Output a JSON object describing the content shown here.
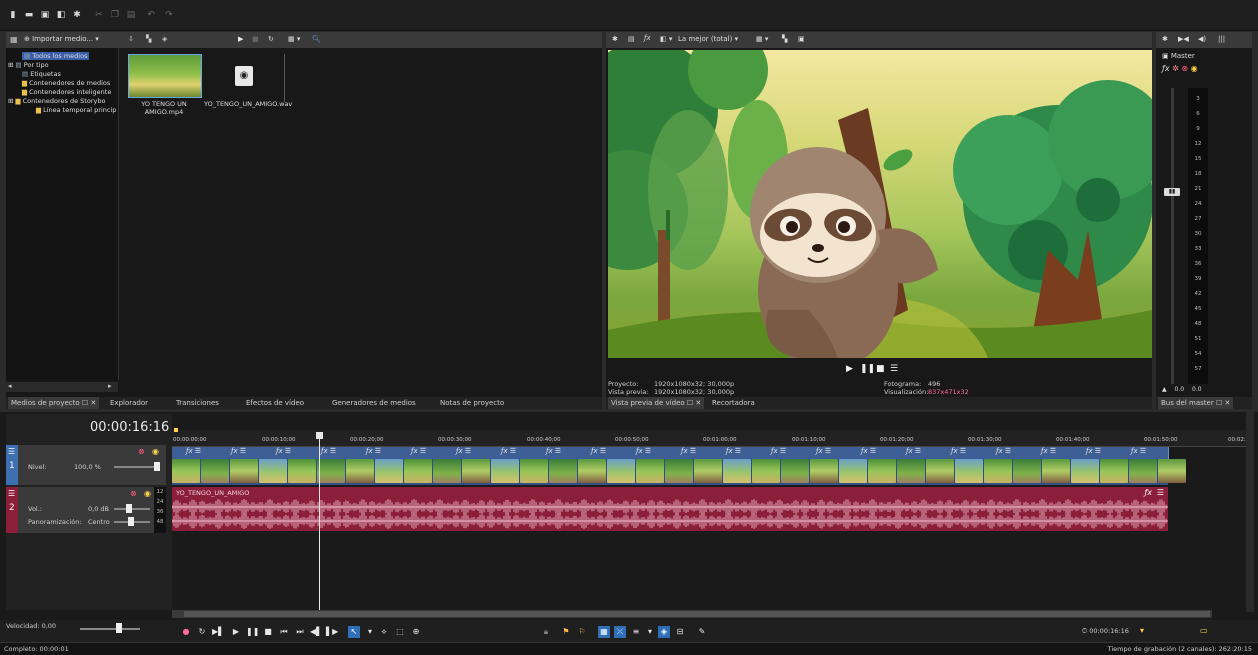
{
  "toolbar": {
    "import_media": "Importar medio...",
    "preview_quality": "La mejor (total)"
  },
  "media_tree": {
    "items": [
      "Todos los medios",
      "Por tipo",
      "Etiquetas",
      "Contenedores de medios",
      "Contenedores inteligente",
      "Contenedores de Storybo",
      "Línea temporal princip"
    ]
  },
  "media_files": [
    {
      "name": "YO TENGO UN AMIGO.mp4"
    },
    {
      "name": "YO_TENGO_UN_AMIGO.wav"
    }
  ],
  "left_tabs": [
    "Medios de proyecto",
    "Explorador",
    "Transiciones",
    "Efectos de vídeo",
    "Generadores de medios",
    "Notas de proyecto"
  ],
  "preview": {
    "project_label": "Proyecto:",
    "project_value": "1920x1080x32; 30,000p",
    "preview_label": "Vista previa:",
    "preview_value": "1920x1080x32; 30,000p",
    "frame_label": "Fotograma:",
    "frame_value": "496",
    "display_label": "Visualización:",
    "display_value": "837x471x32",
    "tabs": [
      "Vista previa de vídeo",
      "Recortadora"
    ]
  },
  "master": {
    "title": "Master",
    "scale": [
      "3",
      "6",
      "9",
      "12",
      "15",
      "18",
      "21",
      "24",
      "27",
      "30",
      "33",
      "36",
      "39",
      "42",
      "45",
      "48",
      "51",
      "54",
      "57"
    ],
    "left_value": "0.0",
    "right_value": "0.0",
    "tab": "Bus del master"
  },
  "timeline": {
    "timecode": "00:00:16:16",
    "ruler": [
      "00:00:00;00",
      "00:00:10;00",
      "00:00:20;00",
      "00:00:30;00",
      "00:00:40;00",
      "00:00:50;00",
      "00:01:00;00",
      "00:01:10;00",
      "00:01:20;00",
      "00:01:30;00",
      "00:01:40;00",
      "00:01:50;00",
      "00:02:"
    ],
    "video_track": {
      "number": "1",
      "level_label": "Nivel:",
      "level_value": "100,0 %"
    },
    "audio_track": {
      "number": "2",
      "vol_label": "Vol.:",
      "vol_value": "0,0 dB",
      "pan_label": "Panoramización:",
      "pan_value": "Centro",
      "clip_name": "YO_TENGO_UN_AMIGO",
      "meter_ticks": [
        "12",
        "24",
        "36",
        "48"
      ]
    },
    "speed_label": "Velocidad: 0,00",
    "end_timecode": "00:00:16:16"
  },
  "status": {
    "left": "Completo: 00:00:01",
    "right": "Tiempo de grabación (2 canales): 262:20:15"
  },
  "colors": {
    "background": "#2b2b2b",
    "video_track": "#3e5f96",
    "audio_track": "#8b1f3a",
    "accent_pink": "#ff6a9a"
  }
}
